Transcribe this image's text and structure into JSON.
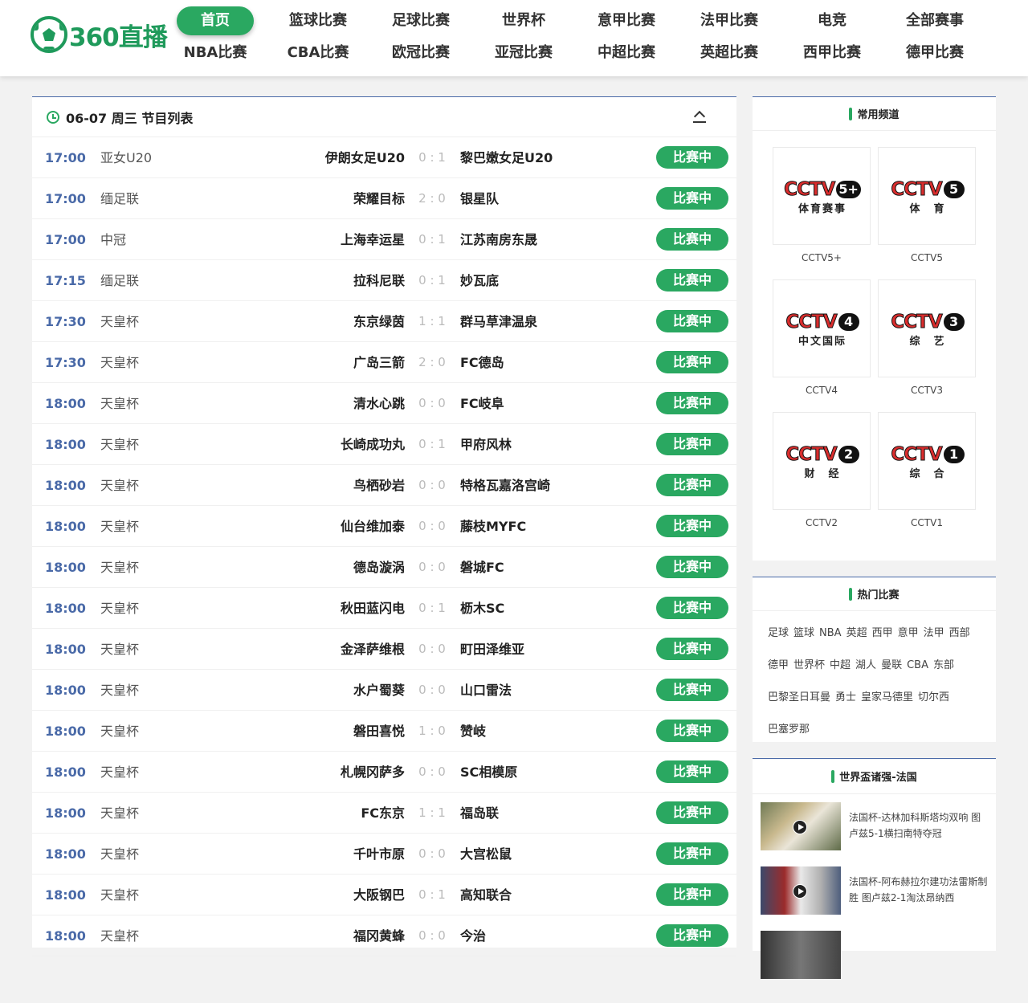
{
  "header": {
    "logo_text": "360直播",
    "nav": [
      {
        "label": "首页",
        "active": true
      },
      {
        "label": "篮球比赛"
      },
      {
        "label": "足球比赛"
      },
      {
        "label": "世界杯"
      },
      {
        "label": "意甲比赛"
      },
      {
        "label": "法甲比赛"
      },
      {
        "label": "电竞"
      },
      {
        "label": "全部赛事"
      },
      {
        "label": "NBA比赛"
      },
      {
        "label": "CBA比赛"
      },
      {
        "label": "欧冠比赛"
      },
      {
        "label": "亚冠比赛"
      },
      {
        "label": "中超比赛"
      },
      {
        "label": "英超比赛"
      },
      {
        "label": "西甲比赛"
      },
      {
        "label": "德甲比赛"
      }
    ]
  },
  "schedule": {
    "title": "06-07 周三 节目列表",
    "matches": [
      {
        "time": "17:00",
        "league": "亚女U20",
        "home": "伊朗女足U20",
        "score": "0 : 1",
        "away": "黎巴嫩女足U20",
        "status": "比赛中"
      },
      {
        "time": "17:00",
        "league": "缅足联",
        "home": "荣耀目标",
        "score": "2 : 0",
        "away": "银星队",
        "status": "比赛中"
      },
      {
        "time": "17:00",
        "league": "中冠",
        "home": "上海幸运星",
        "score": "0 : 1",
        "away": "江苏南房东晟",
        "status": "比赛中"
      },
      {
        "time": "17:15",
        "league": "缅足联",
        "home": "拉科尼联",
        "score": "0 : 1",
        "away": "妙瓦底",
        "status": "比赛中"
      },
      {
        "time": "17:30",
        "league": "天皇杯",
        "home": "东京绿茵",
        "score": "1 : 1",
        "away": "群马草津温泉",
        "status": "比赛中"
      },
      {
        "time": "17:30",
        "league": "天皇杯",
        "home": "广岛三箭",
        "score": "2 : 0",
        "away": "FC德岛",
        "status": "比赛中"
      },
      {
        "time": "18:00",
        "league": "天皇杯",
        "home": "清水心跳",
        "score": "0 : 0",
        "away": "FC岐阜",
        "status": "比赛中"
      },
      {
        "time": "18:00",
        "league": "天皇杯",
        "home": "长崎成功丸",
        "score": "0 : 1",
        "away": "甲府风林",
        "status": "比赛中"
      },
      {
        "time": "18:00",
        "league": "天皇杯",
        "home": "鸟栖砂岩",
        "score": "0 : 0",
        "away": "特格瓦嘉洛宫崎",
        "status": "比赛中"
      },
      {
        "time": "18:00",
        "league": "天皇杯",
        "home": "仙台维加泰",
        "score": "0 : 0",
        "away": "藤枝MYFC",
        "status": "比赛中"
      },
      {
        "time": "18:00",
        "league": "天皇杯",
        "home": "德岛漩涡",
        "score": "0 : 0",
        "away": "磐城FC",
        "status": "比赛中"
      },
      {
        "time": "18:00",
        "league": "天皇杯",
        "home": "秋田蓝闪电",
        "score": "0 : 1",
        "away": "枥木SC",
        "status": "比赛中"
      },
      {
        "time": "18:00",
        "league": "天皇杯",
        "home": "金泽萨维根",
        "score": "0 : 0",
        "away": "町田泽维亚",
        "status": "比赛中"
      },
      {
        "time": "18:00",
        "league": "天皇杯",
        "home": "水户蜀葵",
        "score": "0 : 0",
        "away": "山口雷法",
        "status": "比赛中"
      },
      {
        "time": "18:00",
        "league": "天皇杯",
        "home": "磐田喜悦",
        "score": "1 : 0",
        "away": "赞岐",
        "status": "比赛中"
      },
      {
        "time": "18:00",
        "league": "天皇杯",
        "home": "札幌冈萨多",
        "score": "0 : 0",
        "away": "SC相模原",
        "status": "比赛中"
      },
      {
        "time": "18:00",
        "league": "天皇杯",
        "home": "FC东京",
        "score": "1 : 1",
        "away": "福岛联",
        "status": "比赛中"
      },
      {
        "time": "18:00",
        "league": "天皇杯",
        "home": "千叶市原",
        "score": "0 : 0",
        "away": "大宫松鼠",
        "status": "比赛中"
      },
      {
        "time": "18:00",
        "league": "天皇杯",
        "home": "大阪钢巴",
        "score": "0 : 1",
        "away": "高知联合",
        "status": "比赛中"
      },
      {
        "time": "18:00",
        "league": "天皇杯",
        "home": "福冈黄蜂",
        "score": "0 : 0",
        "away": "今治",
        "status": "比赛中"
      }
    ]
  },
  "channels": {
    "title": "常用频道",
    "items": [
      {
        "num": "5+",
        "sub": "体育赛事",
        "caption": "CCTV5+"
      },
      {
        "num": "5",
        "sub": "体　育",
        "caption": "CCTV5"
      },
      {
        "num": "4",
        "sub": "中文国际",
        "caption": "CCTV4"
      },
      {
        "num": "3",
        "sub": "综　艺",
        "caption": "CCTV3"
      },
      {
        "num": "2",
        "sub": "财　经",
        "caption": "CCTV2"
      },
      {
        "num": "1",
        "sub": "综　合",
        "caption": "CCTV1"
      }
    ]
  },
  "hot": {
    "title": "热门比赛",
    "tags": [
      "足球",
      "篮球",
      "NBA",
      "英超",
      "西甲",
      "意甲",
      "法甲",
      "西部",
      "德甲",
      "世界杯",
      "中超",
      "湖人",
      "曼联",
      "CBA",
      "东部",
      "巴黎圣日耳曼",
      "勇士",
      "皇家马德里",
      "切尔西",
      "巴塞罗那"
    ]
  },
  "news": {
    "title": "世界盃诸强-法国",
    "items": [
      {
        "text": "法国杯-达林加科斯塔均双响 图卢兹5-1横扫南特夺冠"
      },
      {
        "text": "法国杯-阿布赫拉尔建功法雷斯制胜 图卢兹2-1淘汰昂纳西"
      }
    ]
  },
  "colors": {
    "accent": "#2aa861",
    "time": "#4a6aa8",
    "logo": "#1f9a5b"
  }
}
